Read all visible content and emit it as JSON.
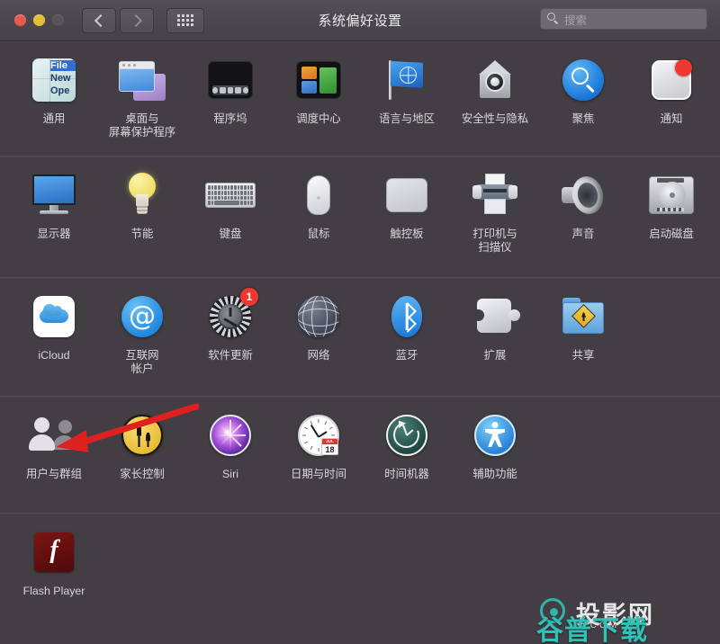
{
  "window": {
    "title": "系统偏好设置",
    "traffic_lights": [
      {
        "name": "close",
        "color": "#e8584f"
      },
      {
        "name": "minimize",
        "color": "#e3bd35"
      },
      {
        "name": "zoom",
        "color": "#57545a"
      }
    ],
    "nav": {
      "back_icon": "chevron-left-icon",
      "forward_icon": "chevron-right-icon",
      "grid_icon": "grid-view-icon"
    },
    "search": {
      "placeholder": "搜索",
      "value": "",
      "icon": "search-icon"
    }
  },
  "rows": [
    {
      "name": "personal-row",
      "items": [
        {
          "label": "通用",
          "icon": "general-icon",
          "badge": null
        },
        {
          "label": "桌面与\n屏幕保护程序",
          "icon": "desktop-screensaver-icon",
          "badge": null
        },
        {
          "label": "程序坞",
          "icon": "dock-icon",
          "badge": null
        },
        {
          "label": "调度中心",
          "icon": "mission-control-icon",
          "badge": null
        },
        {
          "label": "语言与地区",
          "icon": "language-region-icon",
          "badge": null
        },
        {
          "label": "安全性与隐私",
          "icon": "security-privacy-icon",
          "badge": null
        },
        {
          "label": "聚焦",
          "icon": "spotlight-icon",
          "badge": null
        },
        {
          "label": "通知",
          "icon": "notifications-icon",
          "badge": "dot"
        }
      ]
    },
    {
      "name": "hardware-row",
      "items": [
        {
          "label": "显示器",
          "icon": "displays-icon",
          "badge": null
        },
        {
          "label": "节能",
          "icon": "energy-saver-icon",
          "badge": null
        },
        {
          "label": "键盘",
          "icon": "keyboard-icon",
          "badge": null
        },
        {
          "label": "鼠标",
          "icon": "mouse-icon",
          "badge": null
        },
        {
          "label": "触控板",
          "icon": "trackpad-icon",
          "badge": null
        },
        {
          "label": "打印机与\n扫描仪",
          "icon": "printers-scanners-icon",
          "badge": null
        },
        {
          "label": "声音",
          "icon": "sound-icon",
          "badge": null
        },
        {
          "label": "启动磁盘",
          "icon": "startup-disk-icon",
          "badge": null
        }
      ]
    },
    {
      "name": "internet-row",
      "items": [
        {
          "label": "iCloud",
          "icon": "icloud-icon",
          "badge": null
        },
        {
          "label": "互联网\n帐户",
          "icon": "internet-accounts-icon",
          "badge": null
        },
        {
          "label": "软件更新",
          "icon": "software-update-icon",
          "badge": "1"
        },
        {
          "label": "网络",
          "icon": "network-icon",
          "badge": null
        },
        {
          "label": "蓝牙",
          "icon": "bluetooth-icon",
          "badge": null
        },
        {
          "label": "扩展",
          "icon": "extensions-icon",
          "badge": null
        },
        {
          "label": "共享",
          "icon": "sharing-icon",
          "badge": null
        }
      ]
    },
    {
      "name": "system-row",
      "items": [
        {
          "label": "用户与群组",
          "icon": "users-groups-icon",
          "badge": null
        },
        {
          "label": "家长控制",
          "icon": "parental-controls-icon",
          "badge": null
        },
        {
          "label": "Siri",
          "icon": "siri-icon",
          "badge": null
        },
        {
          "label": "日期与时间",
          "icon": "date-time-icon",
          "badge": null
        },
        {
          "label": "时间机器",
          "icon": "time-machine-icon",
          "badge": null
        },
        {
          "label": "辅助功能",
          "icon": "accessibility-icon",
          "badge": null
        }
      ]
    },
    {
      "name": "third-party-row",
      "items": [
        {
          "label": "Flash Player",
          "icon": "flash-player-icon",
          "badge": null
        }
      ]
    }
  ],
  "icon_details": {
    "general_menu": {
      "line1": "File",
      "line2": "New",
      "line3": "Ope"
    },
    "date_time": {
      "month": "JUL",
      "day": "18"
    },
    "flash": {
      "glyph": "f"
    }
  },
  "annotation": {
    "name": "red-arrow",
    "color": "#e02020",
    "points_to": "用户与群组"
  },
  "watermarks": {
    "primary": "谷普下载",
    "secondary": "投影网",
    "domain": ".COM"
  }
}
